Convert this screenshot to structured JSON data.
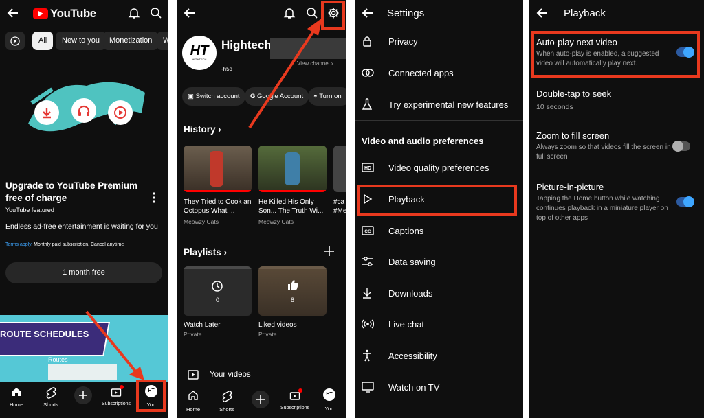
{
  "panel1": {
    "logo_text": "YouTube",
    "chips": [
      "All",
      "New to you",
      "Monetization",
      "W"
    ],
    "promo": {
      "title": "Upgrade to YouTube Premium free of charge",
      "featured": "YouTube featured",
      "tagline": "Endless ad-free entertainment is waiting for you",
      "terms_link": "Terms apply.",
      "terms_rest": " Monthly paid subscription. Cancel anytime",
      "cta": "1 month free"
    },
    "banner_text": "ROUTE SCHEDULES",
    "banner_sub": "Routes",
    "nav": [
      "Home",
      "Shorts",
      "Subscriptions",
      "You"
    ],
    "avatar_text": "HT"
  },
  "panel2": {
    "channel_name": "Hightech",
    "handle": "-h5d",
    "view_channel": "View channel",
    "pills": [
      "Switch account",
      "Google Account",
      "Turn on I"
    ],
    "history_heading": "History",
    "history": [
      {
        "title": "They Tried to Cook an Octopus What ...",
        "channel": "Meowzy Cats"
      },
      {
        "title": "He Killed His Only Son... The Truth Wi...",
        "channel": "Meowzy Cats"
      },
      {
        "title": "#ca #Me",
        "channel": ""
      }
    ],
    "playlists_heading": "Playlists",
    "playlists": [
      {
        "name": "Watch Later",
        "privacy": "Private",
        "count": "0"
      },
      {
        "name": "Liked videos",
        "privacy": "Private",
        "count": "8"
      }
    ],
    "your_videos": "Your videos",
    "nav": [
      "Home",
      "Shorts",
      "Subscriptions",
      "You"
    ],
    "logo_text": "HT",
    "logo_sub": "HIGHTECH"
  },
  "panel3": {
    "title": "Settings",
    "items_top": [
      "Privacy",
      "Connected apps",
      "Try experimental new features"
    ],
    "section": "Video and audio preferences",
    "items": [
      "Video quality preferences",
      "Playback",
      "Captions",
      "Data saving",
      "Downloads",
      "Live chat",
      "Accessibility",
      "Watch on TV"
    ]
  },
  "panel4": {
    "title": "Playback",
    "settings": [
      {
        "label": "Auto-play next video",
        "desc": "When auto-play is enabled, a suggested video will automatically play next.",
        "toggle": true
      },
      {
        "label": "Double-tap to seek",
        "desc": "10 seconds"
      },
      {
        "label": "Zoom to fill screen",
        "desc": "Always zoom so that videos fill the screen in full screen",
        "toggle": false
      },
      {
        "label": "Picture-in-picture",
        "desc": "Tapping the Home button while watching continues playback in a miniature player on top of other apps",
        "toggle": true
      }
    ]
  },
  "colors": {
    "annotation": "#e8391e",
    "toggle_on": "#3ea6ff",
    "bg": "#0f0f0f",
    "brand_red": "#ff0000"
  }
}
